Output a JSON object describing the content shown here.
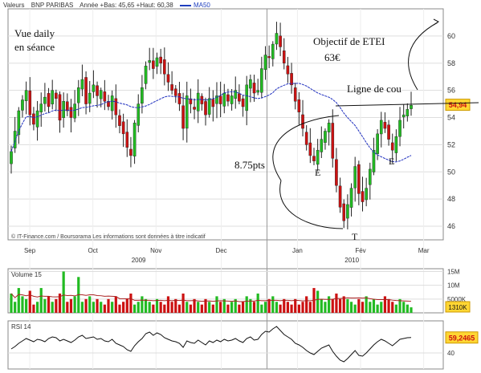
{
  "header": {
    "series": "Valeurs",
    "symbol": "BNP PARIBAS",
    "range": "Année +Bas: 45,65 +Haut: 60,38",
    "ma_legend": "MA50"
  },
  "footer_note": "© IT-Finance.com / Boursorama Les informations sont données à titre indicatif",
  "colors": {
    "up": "#22bb22",
    "down": "#cc1111",
    "ma": "#1f2fbf",
    "volume_ma": "#aa2222",
    "axis": "#888888",
    "grid": "#dddddd"
  },
  "chart_data": [
    {
      "type": "candlestick",
      "title": "",
      "price_axis": {
        "ticks": [
          46,
          48,
          50,
          52,
          54,
          56,
          58,
          60
        ],
        "ylim": [
          45,
          62
        ]
      },
      "time_axis": {
        "months": [
          "Sep",
          "Oct",
          "Nov",
          "Dec",
          "Jan",
          "Fév",
          "Mar"
        ],
        "years": [
          "2009",
          "2010"
        ]
      },
      "last_price": "54,94",
      "close_series": [
        51.5,
        53.0,
        54.5,
        55.3,
        56.0,
        54.2,
        53.5,
        54.5,
        55.0,
        55.5,
        54.8,
        56.0,
        55.4,
        53.8,
        55.2,
        54.5,
        54.0,
        55.0,
        56.2,
        56.8,
        55.0,
        55.8,
        56.4,
        55.6,
        56.0,
        55.2,
        54.8,
        55.6,
        54.2,
        53.4,
        52.8,
        51.8,
        51.2,
        53.6,
        55.0,
        56.2,
        57.8,
        58.2,
        57.6,
        58.4,
        58.0,
        57.2,
        56.6,
        56.0,
        55.6,
        55.0,
        53.2,
        55.6,
        55.0,
        54.6,
        55.8,
        55.0,
        54.2,
        55.4,
        54.8,
        55.6,
        55.0,
        55.8,
        55.2,
        55.6,
        56.0,
        55.2,
        54.8,
        56.4,
        56.8,
        55.8,
        56.0,
        57.6,
        58.6,
        58.4,
        59.4,
        60.2,
        59.2,
        58.0,
        57.2,
        56.4,
        55.2,
        54.4,
        53.2,
        52.0,
        51.2,
        50.8,
        51.6,
        52.4,
        53.0,
        53.6,
        51.0,
        49.0,
        47.4,
        46.4,
        47.6,
        48.8,
        50.4,
        48.4,
        47.8,
        48.8,
        50.2,
        51.6,
        52.8,
        53.8,
        53.2,
        52.4,
        51.6,
        52.6,
        53.8,
        54.2,
        54.6,
        54.9
      ],
      "annotations": [
        "Vue daily",
        "en séance",
        "Objectif de ETEI",
        "63€",
        "Ligne de cou",
        "8.75pts",
        "E",
        "T",
        "E"
      ]
    },
    {
      "type": "bar",
      "title": "Volume 15",
      "yticks": [
        "15M",
        "10M",
        "5000K"
      ],
      "last_value": "1310K",
      "values": [
        7,
        4,
        9,
        6,
        5,
        8,
        3,
        4,
        9,
        5,
        6,
        4,
        5,
        7,
        15,
        4,
        5,
        6,
        13,
        4,
        5,
        6,
        4,
        5,
        4,
        3,
        5,
        4,
        6,
        3,
        4,
        5,
        7,
        3,
        4,
        6,
        5,
        4,
        3,
        5,
        4,
        3,
        6,
        4,
        5,
        3,
        7,
        4,
        3,
        5,
        4,
        3,
        5,
        4,
        3,
        6,
        4,
        5,
        3,
        4,
        5,
        3,
        4,
        6,
        5,
        4,
        7,
        3,
        4,
        5,
        6,
        4,
        3,
        5,
        4,
        3,
        5,
        3,
        4,
        6,
        4,
        9,
        8,
        5,
        4,
        6,
        5,
        7,
        5,
        6,
        5,
        4,
        3,
        5,
        4,
        6,
        4,
        5,
        3,
        4,
        6,
        5,
        4,
        3,
        5,
        4,
        3,
        2
      ]
    },
    {
      "type": "line",
      "title": "RSI 14",
      "yticks": [
        "40"
      ],
      "last_value": "59,2465",
      "values": [
        45,
        48,
        52,
        55,
        58,
        56,
        54,
        57,
        56,
        54,
        58,
        60,
        59,
        55,
        57,
        55,
        53,
        56,
        60,
        62,
        58,
        59,
        60,
        57,
        58,
        55,
        54,
        57,
        52,
        50,
        48,
        44,
        42,
        49,
        54,
        58,
        64,
        66,
        62,
        65,
        63,
        59,
        57,
        55,
        54,
        52,
        47,
        55,
        53,
        52,
        56,
        53,
        50,
        55,
        53,
        56,
        54,
        57,
        55,
        56,
        58,
        55,
        53,
        58,
        60,
        56,
        57,
        63,
        67,
        66,
        70,
        73,
        68,
        63,
        60,
        57,
        52,
        50,
        47,
        43,
        40,
        38,
        42,
        46,
        48,
        50,
        42,
        36,
        31,
        29,
        33,
        38,
        43,
        37,
        36,
        40,
        45,
        50,
        54,
        57,
        55,
        52,
        49,
        53,
        57,
        58,
        59,
        59.2
      ]
    }
  ]
}
